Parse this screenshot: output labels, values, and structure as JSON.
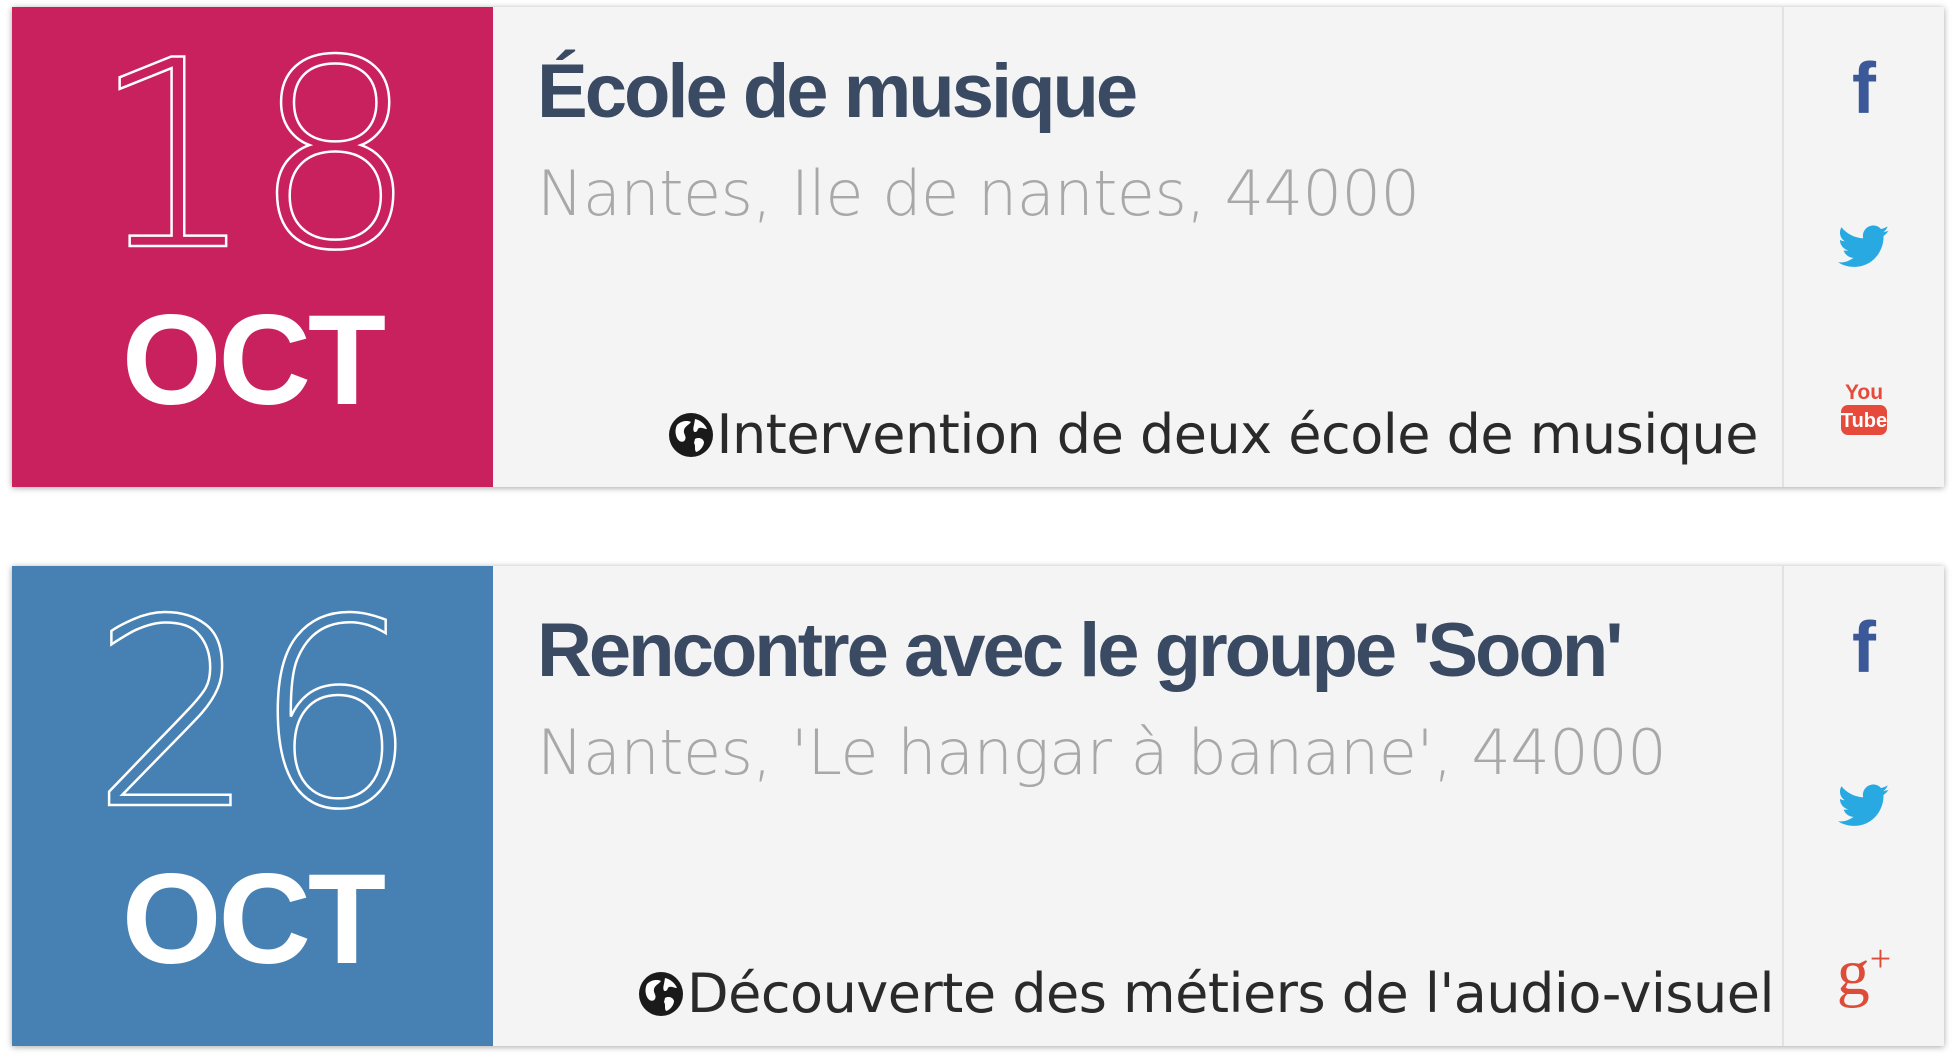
{
  "colors": {
    "card1_accent": "#c8215e",
    "card2_accent": "#4780b2",
    "facebook": "#3b5998",
    "twitter": "#29a9e1",
    "youtube": "#e54a3a",
    "google_plus": "#dd4b39"
  },
  "events": [
    {
      "day": "18",
      "month": "OCT",
      "title": "École de musique",
      "place": "Nantes, Ile de nantes, 44000",
      "description": "Intervention de deux école de musique",
      "social": [
        "facebook-icon",
        "twitter-icon",
        "youtube-icon"
      ]
    },
    {
      "day": "26",
      "month": "OCT",
      "title": "Rencontre avec le groupe 'Soon'",
      "place": "Nantes, 'Le hangar à banane', 44000",
      "description": "Découverte des métiers de l'audio-visuel",
      "social": [
        "facebook-icon",
        "twitter-icon",
        "google-plus-icon"
      ]
    }
  ],
  "icons": {
    "facebook_glyph": "f",
    "youtube_top": "You",
    "youtube_bottom": "Tube",
    "gplus_glyph": "g",
    "gplus_plus": "+"
  }
}
